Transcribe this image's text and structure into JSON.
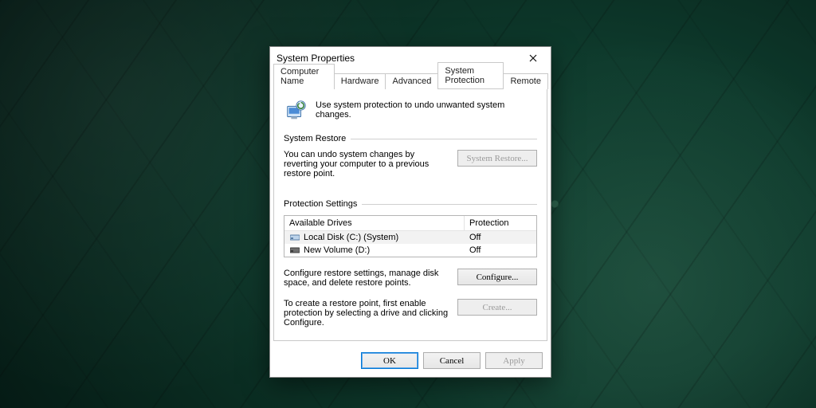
{
  "window": {
    "title": "System Properties"
  },
  "tabs": {
    "items": [
      "Computer Name",
      "Hardware",
      "Advanced",
      "System Protection",
      "Remote"
    ],
    "activeIndex": 3
  },
  "intro": "Use system protection to undo unwanted system changes.",
  "restore": {
    "group_label": "System Restore",
    "desc": "You can undo system changes by reverting your computer to a previous restore point.",
    "button": "System Restore..."
  },
  "protection": {
    "group_label": "Protection Settings",
    "columns": {
      "drives": "Available Drives",
      "prot": "Protection"
    },
    "drives": [
      {
        "name": "Local Disk (C:) (System)",
        "protection": "Off",
        "selected": true,
        "icon": "disk"
      },
      {
        "name": "New Volume (D:)",
        "protection": "Off",
        "selected": false,
        "icon": "disk-dark"
      }
    ],
    "configure": {
      "desc": "Configure restore settings, manage disk space, and delete restore points.",
      "button": "Configure..."
    },
    "create": {
      "desc": "To create a restore point, first enable protection by selecting a drive and clicking Configure.",
      "button": "Create..."
    }
  },
  "buttons": {
    "ok": "OK",
    "cancel": "Cancel",
    "apply": "Apply"
  }
}
